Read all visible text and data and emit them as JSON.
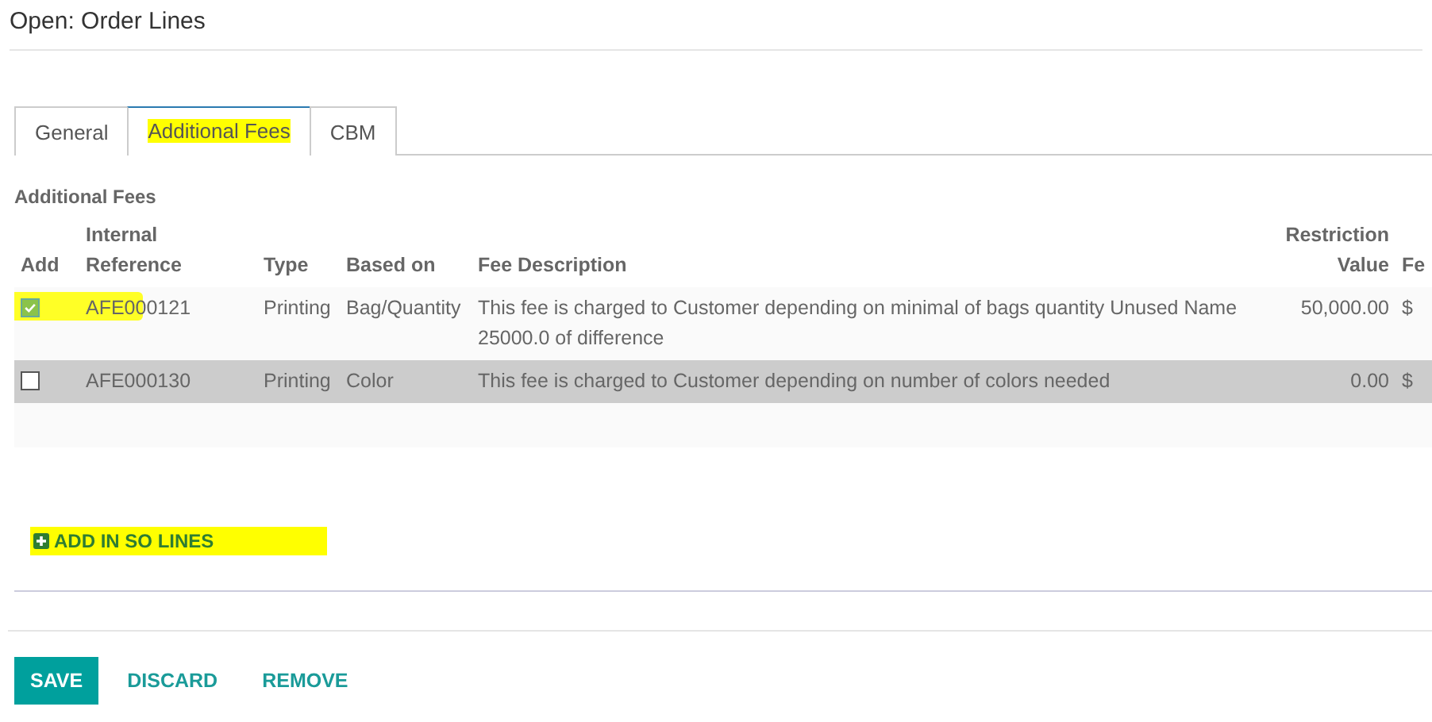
{
  "window": {
    "title": "Open: Order Lines"
  },
  "tabs": [
    {
      "label": "General",
      "selected": false,
      "highlighted": false
    },
    {
      "label": "Additional Fees",
      "selected": true,
      "highlighted": true
    },
    {
      "label": "CBM",
      "selected": false,
      "highlighted": false
    }
  ],
  "section_title": "Additional Fees",
  "table": {
    "columns": [
      {
        "label": "Add"
      },
      {
        "label": "Internal Reference"
      },
      {
        "label": "Type"
      },
      {
        "label": "Based on"
      },
      {
        "label": "Fee Description"
      },
      {
        "label": "Restriction Value"
      },
      {
        "label": "Fe"
      }
    ],
    "rows": [
      {
        "checked": true,
        "highlighted": true,
        "selected": false,
        "reference": "AFE000121",
        "type": "Printing",
        "based_on": "Bag/Quantity",
        "description": "This fee is charged to Customer depending on minimal of bags quantity Unused Name 25000.0 of difference",
        "restriction_value": "50,000.00",
        "column_7": "$"
      },
      {
        "checked": false,
        "highlighted": false,
        "selected": true,
        "reference": "AFE000130",
        "type": "Printing",
        "based_on": "Color",
        "description": "This fee is charged to Customer depending on number of colors needed",
        "restriction_value": "0.00",
        "column_7": "$"
      }
    ]
  },
  "add_button": {
    "label": "ADD IN SO LINES",
    "highlighted": true
  },
  "buttons": [
    {
      "label": "SAVE",
      "kind": "primary"
    },
    {
      "label": "DISCARD",
      "kind": "link"
    },
    {
      "label": "REMOVE",
      "kind": "link"
    }
  ]
}
